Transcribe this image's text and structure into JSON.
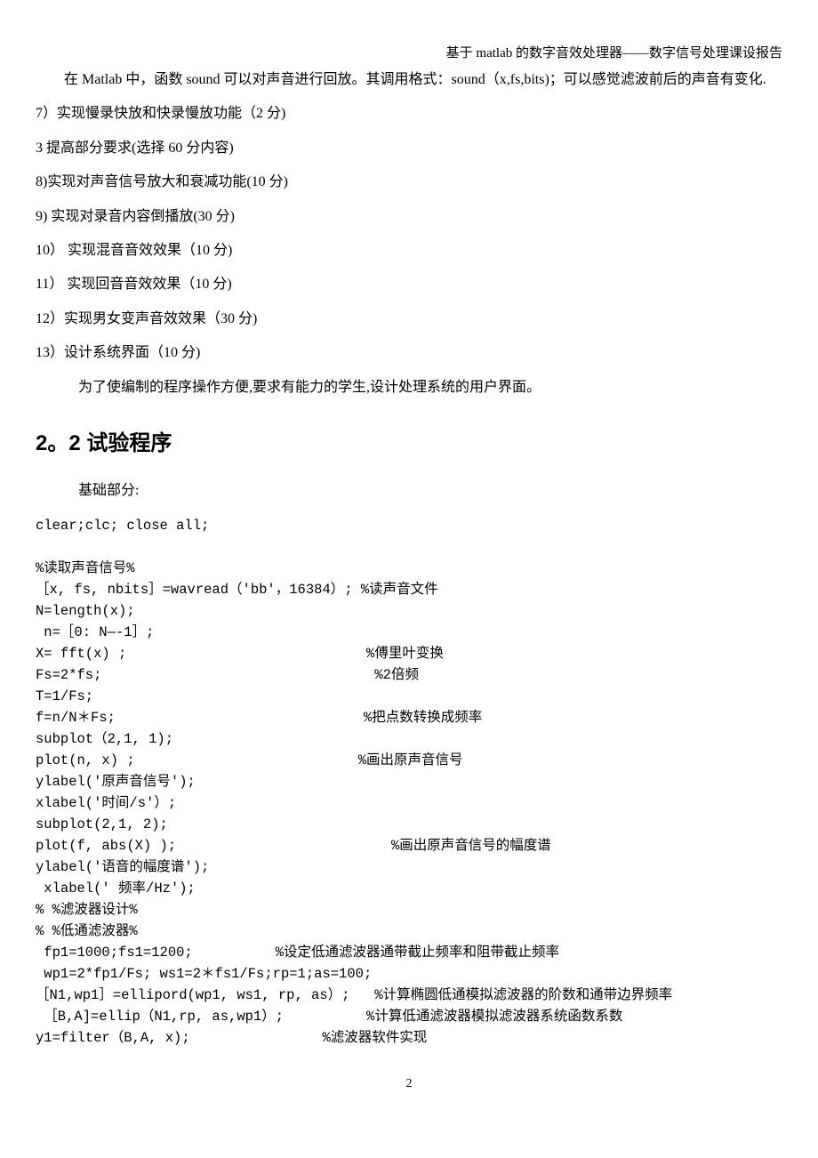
{
  "header": "基于 matlab 的数字音效处理器——数字信号处理课设报告",
  "p1": "在 Matlab 中，函数 sound 可以对声音进行回放。其调用格式：sound（x,fs,bits)；可以感觉滤波前后的声音有变化.",
  "i7": "7）实现慢录快放和快录慢放功能（2 分)",
  "i3h": "3 提高部分要求(选择 60 分内容)",
  "i8": "8)实现对声音信号放大和衰减功能(10 分)",
  "i9": "9) 实现对录音内容倒播放(30 分)",
  "i10": "10） 实现混音音效效果（10 分)",
  "i11": "11） 实现回音音效效果（10 分)",
  "i12": "12）实现男女变声音效效果（30 分)",
  "i13": "13）设计系统界面（10 分)",
  "p14": "为了使编制的程序操作方便,要求有能力的学生,设计处理系统的用户界面。",
  "section": "2。2 试验程序",
  "basepart": "基础部分:",
  "code": "clear;clc; close all;\n\n%读取声音信号%\n［x, fs, nbits］=wavread（'bb'，16384）; %读声音文件\nN=length(x);\n n=［0: N—-1］;\nX= fft(x) ;                             %傅里叶变换\nFs=2*fs;                                 %2倍频\nT=1/Fs;\nf=n/N＊Fs;                              %把点数转换成频率\nsubplot（2,1, 1);\nplot(n, x) ;                           %画出原声音信号\nylabel('原声音信号');\nxlabel('时间/s'）;\nsubplot(2,1, 2);\nplot(f, abs(X) );                          %画出原声音信号的幅度谱\nylabel('语音的幅度谱');\n xlabel(' 频率/Hz');\n% %滤波器设计%\n% %低通滤波器%\n fp1=1000;fs1=1200;          %设定低通滤波器通带截止频率和阻带截止频率\n wp1=2*fp1/Fs; ws1=2＊fs1/Fs;rp=1;as=100;\n［N1,wp1］=ellipord(wp1, ws1, rp, as）;   %计算椭圆低通模拟滤波器的阶数和通带边界频率\n ［B,A]=ellip（N1,rp, as,wp1）;          %计算低通滤波器模拟滤波器系统函数系数\ny1=filter（B,A, x);                %滤波器软件实现",
  "page": "2"
}
